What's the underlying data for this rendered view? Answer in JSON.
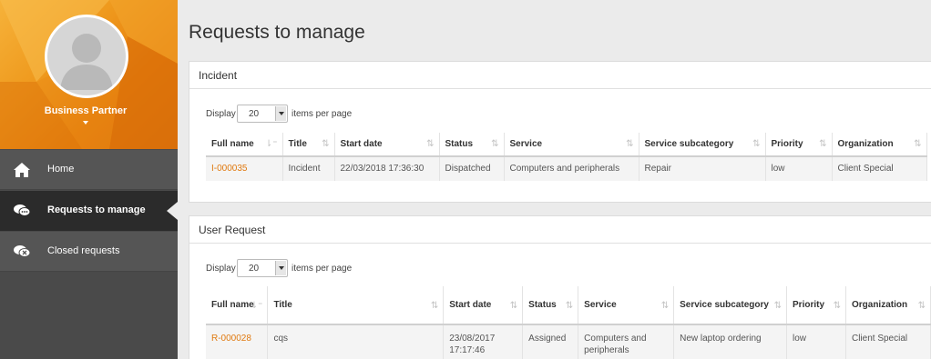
{
  "sidebar": {
    "profile_name": "Business Partner",
    "items": [
      {
        "label": "Home",
        "icon": "home-icon"
      },
      {
        "label": "Requests to manage",
        "icon": "chat-bubbles-icon"
      },
      {
        "label": "Closed requests",
        "icon": "closed-bubbles-icon"
      }
    ]
  },
  "page_title": "Requests to manage",
  "colors": {
    "accent": "#e67e0c",
    "link": "#e07a10",
    "sidebar": "#4a4a4a",
    "active": "#2b2b2b"
  },
  "incident": {
    "title": "Incident",
    "display_label": "Display",
    "page_size": "20",
    "items_per_page": "items per page",
    "columns": [
      "Full name",
      "Title",
      "Start date",
      "Status",
      "Service",
      "Service subcategory",
      "Priority",
      "Organization"
    ],
    "rows": [
      [
        "I-000035",
        "Incident",
        "22/03/2018 17:36:30",
        "Dispatched",
        "Computers and peripherals",
        "Repair",
        "low",
        "Client Special"
      ]
    ]
  },
  "user_request": {
    "title": "User Request",
    "display_label": "Display",
    "page_size": "20",
    "items_per_page": "items per page",
    "columns": [
      "Full name",
      "Title",
      "Start date",
      "Status",
      "Service",
      "Service subcategory",
      "Priority",
      "Organization"
    ],
    "rows": [
      [
        "R-000028",
        "cqs",
        "23/08/2017 17:17:46",
        "Assigned",
        "Computers and peripherals",
        "New laptop ordering",
        "low",
        "Client Special"
      ]
    ]
  }
}
